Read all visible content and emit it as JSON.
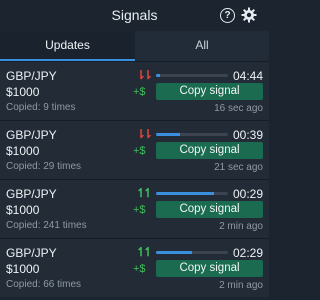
{
  "header": {
    "title": "Signals",
    "help_glyph": "?"
  },
  "tabs": [
    {
      "label": "Updates",
      "active": true
    },
    {
      "label": "All",
      "active": false
    }
  ],
  "signals": [
    {
      "pair": "GBP/JPY",
      "direction": "down",
      "arrow": "⇂⇂",
      "amount": "$1000",
      "plus": "+$",
      "copied": "Copied: 9 times",
      "time": "04:44",
      "progress": 0.05,
      "button": "Copy signal",
      "ago": "16 sec ago"
    },
    {
      "pair": "GBP/JPY",
      "direction": "down",
      "arrow": "⇂⇂",
      "amount": "$1000",
      "plus": "+$",
      "copied": "Copied: 29 times",
      "time": "00:39",
      "progress": 0.33,
      "button": "Copy signal",
      "ago": "21 sec ago"
    },
    {
      "pair": "GBP/JPY",
      "direction": "up",
      "arrow": "↿↿",
      "amount": "$1000",
      "plus": "+$",
      "copied": "Copied: 241 times",
      "time": "00:29",
      "progress": 0.8,
      "button": "Copy signal",
      "ago": "2 min ago"
    },
    {
      "pair": "GBP/JPY",
      "direction": "up",
      "arrow": "↿↿",
      "amount": "$1000",
      "plus": "+$",
      "copied": "Copied: 66 times",
      "time": "02:29",
      "progress": 0.5,
      "button": "Copy signal",
      "ago": "2 min ago"
    }
  ],
  "colors": {
    "accent": "#3a8fdf",
    "button": "#1a6b4f",
    "up": "#3fbf5b",
    "down": "#e0443b"
  }
}
